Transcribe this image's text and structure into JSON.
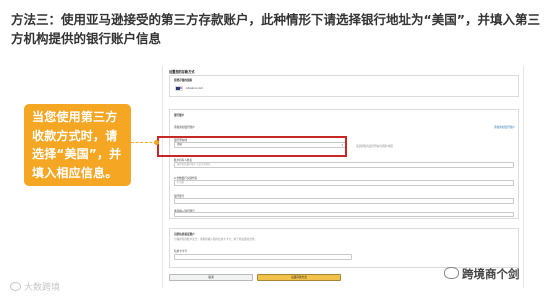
{
  "heading": {
    "prefix": "方法三：",
    "text": "使用亚马逊接受的第三方存款账户，此种情形下请选择银行地址为“美国”，并填入第三方机构提供的银行账户信息"
  },
  "callout": {
    "text": "当您使用第三方收款方式时，请选择“美国”，并填入相应信息。",
    "color": "#f5a623"
  },
  "highlight_color": "#c62828",
  "form": {
    "title": "设置您的存款方式",
    "country_card": {
      "label": "您要存储的国家",
      "value": "Amazon.com"
    },
    "bank_section": {
      "label": "银行账户",
      "sub_label": "添加新的银行账户",
      "link": "添加新的银行账户",
      "bank_location_label": "银行所在地",
      "bank_location_value": "美国",
      "bank_location_hint": "请选择您的银行所在的国家/地区",
      "holder_label": "账户持有人姓名",
      "holder_placeholder": "使用您的银行账户上显示的姓名",
      "routing_label": "9 位数银行识别代码",
      "routing_placeholder": "9 位数",
      "account_label": "银行账号",
      "confirm_label": "重新输入银行账号"
    },
    "verify_section": {
      "label": "识别信息验证账户",
      "note": "为保护您的账户安全，请重新输入您的信用卡卡号，用于验证您的身份。",
      "card_label": "信用卡卡号"
    },
    "cancel_label": "取消",
    "submit_label": "设置存款方式"
  },
  "watermark_left": "大数跨境",
  "watermark_right": "跨境商个剑"
}
